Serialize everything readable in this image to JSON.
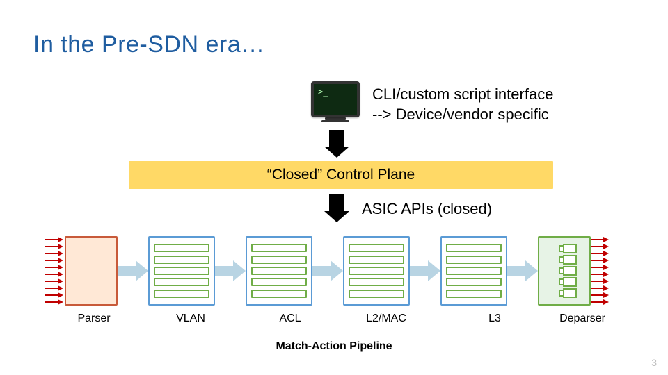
{
  "title": "In the Pre-SDN era…",
  "page_number": "3",
  "cli": {
    "line1": "CLI/custom script interface",
    "line2": "--> Device/vendor specific"
  },
  "control_plane_label": "“Closed” Control Plane",
  "asic_label": "ASIC APIs (closed)",
  "pipeline": {
    "parser_label": "Parser",
    "vlan_label": "VLAN",
    "acl_label": "ACL",
    "l2mac_label": "L2/MAC",
    "l3_label": "L3",
    "deparser_label": "Deparser",
    "caption": "Match-Action Pipeline"
  },
  "icons": {
    "terminal_prompt": ">_"
  },
  "colors": {
    "title": "#1f5da0",
    "control_plane_bg": "#ffd966",
    "stage_border": "#5b9bd5",
    "table_bar_border": "#70ad47",
    "parser_bg": "#ffe8d6",
    "parser_border": "#c85a3a",
    "arrow_red": "#c00000",
    "fat_arrow": "#b8d4e3"
  }
}
